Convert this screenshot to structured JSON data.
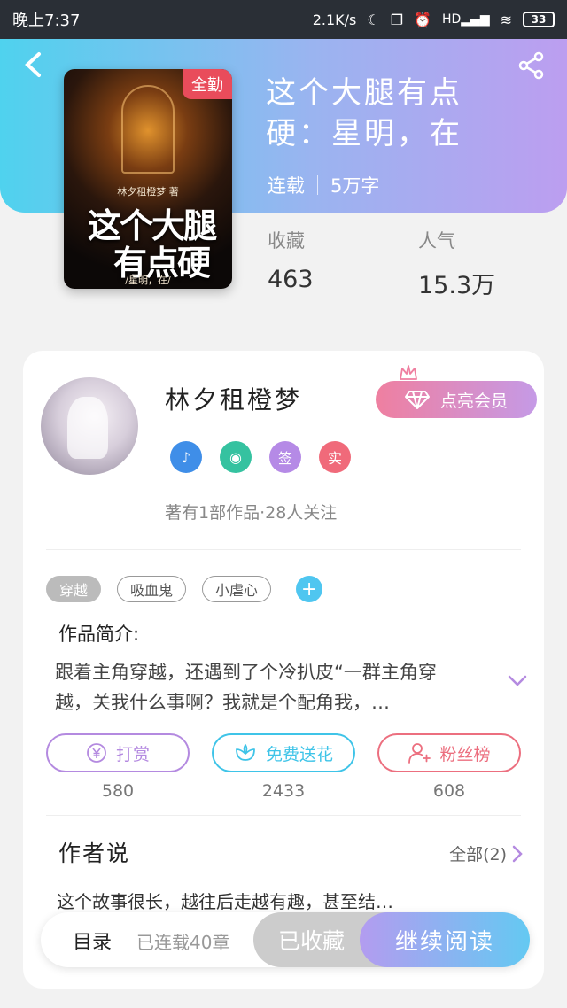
{
  "status_bar": {
    "time": "晚上7:37",
    "speed": "2.1K/s",
    "battery": "33",
    "hd": "HD"
  },
  "book": {
    "cover_tag": "全勤",
    "cover_author": "林夕租橙梦 著",
    "cover_title_line1": "这个大腿",
    "cover_title_line2": "有点硬",
    "cover_subtitle": "/星明，在/",
    "title": "这个大腿有点硬：星明，在",
    "status": "连载",
    "word_count": "5万字",
    "favorites_label": "收藏",
    "favorites_value": "463",
    "popularity_label": "人气",
    "popularity_value": "15.3万"
  },
  "author": {
    "name": "林夕租橙梦",
    "vip_label": "点亮会员",
    "badges": [
      {
        "icon": "music-note-icon",
        "glyph": "♪",
        "color": "#3f8ee8"
      },
      {
        "icon": "handshake-icon",
        "glyph": "◉",
        "color": "#35c2a0"
      },
      {
        "icon": "sign-icon",
        "glyph": "签",
        "color": "#b58ae6"
      },
      {
        "icon": "verified-icon",
        "glyph": "实",
        "color": "#f06a7a"
      }
    ],
    "info": "著有1部作品·28人关注"
  },
  "tags": [
    "穿越",
    "吸血鬼",
    "小虐心"
  ],
  "intro": {
    "label": "作品简介:",
    "text": "跟着主角穿越，还遇到了个冷扒皮“一群主角穿越，关我什么事啊？我就是个配角我，…"
  },
  "actions": [
    {
      "label": "打赏",
      "count": "580",
      "color": "#b48ae0",
      "icon": "yen-icon"
    },
    {
      "label": "免费送花",
      "count": "2433",
      "color": "#3fc4e8",
      "icon": "flower-icon"
    },
    {
      "label": "粉丝榜",
      "count": "608",
      "color": "#ec6f7f",
      "icon": "fan-icon"
    }
  ],
  "author_says": {
    "label": "作者说",
    "all_label": "全部(2)",
    "text": "这个故事很长，越往后走越有趣，甚至结…"
  },
  "bottom": {
    "toc": "目录",
    "toc_status": "已连载40章",
    "fav": "已收藏",
    "read": "继续阅读"
  },
  "colors": {
    "header_start": "#4fd2ee",
    "header_end": "#bc9ef0",
    "accent": "#64c9f2"
  }
}
